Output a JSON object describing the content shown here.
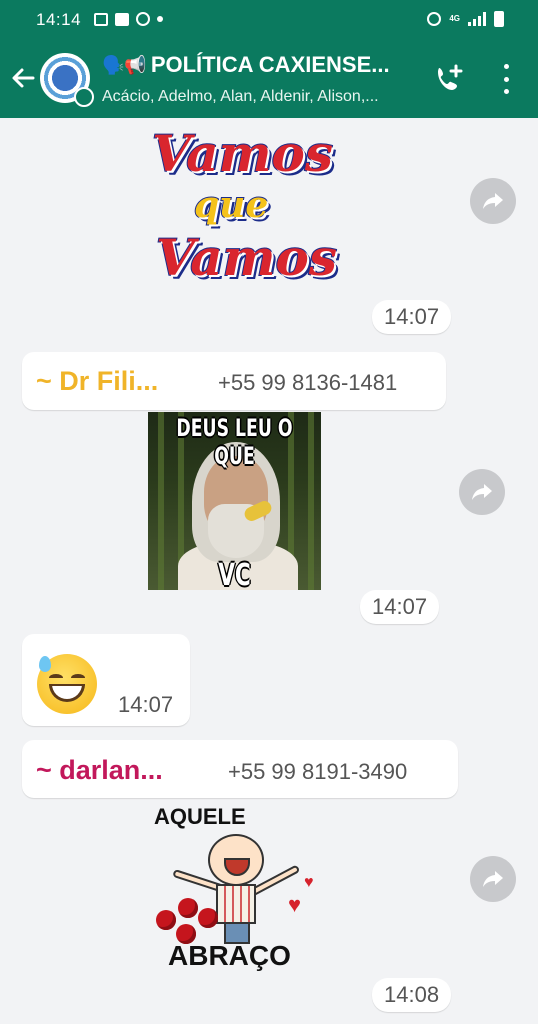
{
  "status_bar": {
    "time": "14:14",
    "network": "4G"
  },
  "header": {
    "title": "POLÍTICA CAXIENSE...",
    "title_emojis": "🗣️📢",
    "subtitle": "Acácio, Adelmo, Alan, Aldenir, Alison,..."
  },
  "messages": [
    {
      "type": "sticker",
      "sticker_lines": [
        "Vamos",
        "que",
        "Vamos"
      ],
      "time": "14:07"
    },
    {
      "type": "image",
      "sender_name": "~ Dr Fili...",
      "sender_phone": "+55 99 8136-1481",
      "sender_color": "#f0b429",
      "caption_top": "DEUS LEU O QUE",
      "caption_bottom": "VC APAGOU",
      "time": "14:07"
    },
    {
      "type": "emoji",
      "emoji": "😅",
      "time": "14:07"
    },
    {
      "type": "sticker",
      "sender_name": "~ darlan...",
      "sender_phone": "+55 99 8191-3490",
      "sender_color": "#c2185b",
      "sticker_lines": [
        "AQUELE",
        "ABRAÇO"
      ],
      "time": "14:08"
    }
  ],
  "colors": {
    "header_bg": "#0b7a5f",
    "chat_bg": "#f2f3f5"
  }
}
